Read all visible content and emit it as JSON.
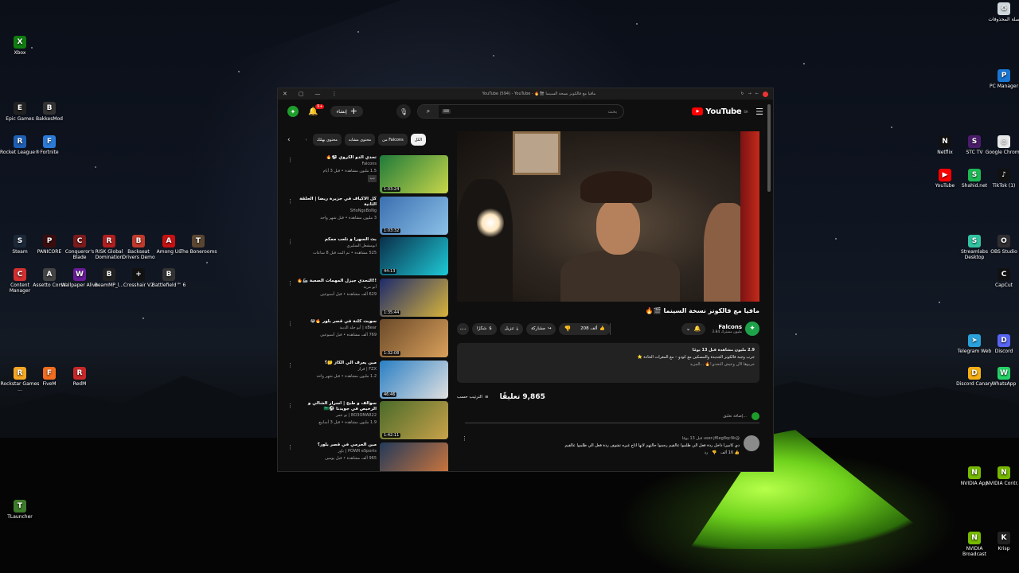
{
  "desktop": {
    "left_icons": [
      {
        "label": "Xbox",
        "icon": "xbox-icon",
        "color": "#107c10",
        "glyph": "X"
      },
      {
        "label": "Epic Games",
        "icon": "epic-games-icon",
        "color": "#222222",
        "glyph": "E"
      },
      {
        "label": "BakkesMod",
        "icon": "bakkesmod-icon",
        "color": "#333333",
        "glyph": "B"
      },
      {
        "label": "Rocket League®",
        "icon": "rocket-league-icon",
        "color": "#1e5fb4",
        "glyph": "R"
      },
      {
        "label": "Fortnite",
        "icon": "fortnite-icon",
        "color": "#2a7bd8",
        "glyph": "F"
      },
      {
        "label": "Steam",
        "icon": "steam-icon",
        "color": "#1b2838",
        "glyph": "S"
      },
      {
        "label": "PANICORE",
        "icon": "panicore-icon",
        "color": "#3a0c0c",
        "glyph": "P"
      },
      {
        "label": "Conqueror's Blade",
        "icon": "conquerors-blade-icon",
        "color": "#7a1a1a",
        "glyph": "C"
      },
      {
        "label": "RISK Global Domination",
        "icon": "risk-icon",
        "color": "#b01e1e",
        "glyph": "R"
      },
      {
        "label": "Backseat Drivers Demo",
        "icon": "backseat-drivers-icon",
        "color": "#c0392b",
        "glyph": "B"
      },
      {
        "label": "Among Us",
        "icon": "among-us-icon",
        "color": "#c51111",
        "glyph": "A"
      },
      {
        "label": "The Bonerooms",
        "icon": "bonerooms-icon",
        "color": "#5a4630",
        "glyph": "T"
      },
      {
        "label": "Content Manager",
        "icon": "content-manager-icon",
        "color": "#d32f2f",
        "glyph": "C"
      },
      {
        "label": "Assetto Corsa",
        "icon": "assetto-corsa-icon",
        "color": "#444444",
        "glyph": "A"
      },
      {
        "label": "Wallpaper Alive",
        "icon": "wallpaper-alive-icon",
        "color": "#6a1b9a",
        "glyph": "W"
      },
      {
        "label": "BeamMP_l...",
        "icon": "beammp-icon",
        "color": "#222222",
        "glyph": "B"
      },
      {
        "label": "Crosshair V2",
        "icon": "crosshair-icon",
        "color": "#111111",
        "glyph": "+"
      },
      {
        "label": "Battlefield™ 6",
        "icon": "battlefield-icon",
        "color": "#333333",
        "glyph": "B"
      },
      {
        "label": "Rockstar Games ...",
        "icon": "rockstar-icon",
        "color": "#f5a623",
        "glyph": "R"
      },
      {
        "label": "FiveM",
        "icon": "fivem-icon",
        "color": "#f06c1e",
        "glyph": "F"
      },
      {
        "label": "RedM",
        "icon": "redm-icon",
        "color": "#c62828",
        "glyph": "R"
      },
      {
        "label": "TLauncher",
        "icon": "tlauncher-icon",
        "color": "#3d7a2a",
        "glyph": "T"
      }
    ],
    "right_icons": [
      {
        "label": "سلة المحذوفات",
        "icon": "recycle-bin-icon",
        "color": "#cfd8dc",
        "glyph": "♻"
      },
      {
        "label": "PC Manager",
        "icon": "pc-manager-icon",
        "color": "#1976d2",
        "glyph": "P"
      },
      {
        "label": "Netflix",
        "icon": "netflix-icon",
        "color": "#111111",
        "glyph": "N"
      },
      {
        "label": "STC TV",
        "icon": "stc-tv-icon",
        "color": "#4b1c6b",
        "glyph": "S"
      },
      {
        "label": "Google Chrome",
        "icon": "chrome-icon",
        "color": "#e8e8e8",
        "glyph": "◎"
      },
      {
        "label": "YouTube",
        "icon": "youtube-icon",
        "color": "#ff0000",
        "glyph": "▶"
      },
      {
        "label": "Shahid.net",
        "icon": "shahid-icon",
        "color": "#1db954",
        "glyph": "S"
      },
      {
        "label": "TikTok (1)",
        "icon": "tiktok-icon",
        "color": "#111111",
        "glyph": "♪"
      },
      {
        "label": "Streamlabs Desktop",
        "icon": "streamlabs-icon",
        "color": "#31c3a2",
        "glyph": "S"
      },
      {
        "label": "OBS Studio",
        "icon": "obs-icon",
        "color": "#302e31",
        "glyph": "O"
      },
      {
        "label": "CapCut",
        "icon": "capcut-icon",
        "color": "#111111",
        "glyph": "C"
      },
      {
        "label": "Telegram Web",
        "icon": "telegram-icon",
        "color": "#2aa1da",
        "glyph": "➤"
      },
      {
        "label": "Discord",
        "icon": "discord-icon",
        "color": "#5865f2",
        "glyph": "D"
      },
      {
        "label": "Discord Canary",
        "icon": "discord-canary-icon",
        "color": "#f5b014",
        "glyph": "D"
      },
      {
        "label": "WhatsApp",
        "icon": "whatsapp-icon",
        "color": "#25d366",
        "glyph": "W"
      },
      {
        "label": "NVIDIA App",
        "icon": "nvidia-app-icon",
        "color": "#76b900",
        "glyph": "N"
      },
      {
        "label": "NVIDIA Contr...",
        "icon": "nvidia-control-icon",
        "color": "#76b900",
        "glyph": "N"
      },
      {
        "label": "NVIDIA Broadcast",
        "icon": "nvidia-broadcast-icon",
        "color": "#76b900",
        "glyph": "N"
      },
      {
        "label": "Krisp",
        "icon": "krisp-icon",
        "color": "#222222",
        "glyph": "K"
      }
    ]
  },
  "window": {
    "title": "مافيا مع فالكونز نسخة السينما 🎬🔥 - YouTube (594) - YouTube"
  },
  "header": {
    "create_label": "إنشاء",
    "notifications": "9+",
    "search_placeholder": "بحث",
    "search_kbd": "⌨",
    "logo_text": "YouTube",
    "logo_region": "SA"
  },
  "video": {
    "title": "مافيا مع فالكونز نسخة السينما 🎬🔥",
    "channel": "Falcons",
    "subscribers": "3.84 مليون مشترك",
    "likes": "208 ألف",
    "share": "مشاركة",
    "download": "تنزيل",
    "thanks": "شكرًا",
    "desc_stats": "2.9 مليون مشاهدة قبل 13 يومًا",
    "desc_line": "جرب وجبة فالكونز الجديدة والمسكين مع كودو – مع المغرات الحادة ⭐",
    "desc_more": "جربوها الآن وعيش التحدي!🔥 ...المزيد"
  },
  "comments": {
    "count": "9,865 تعليقًا",
    "sort_label": "الترتيب حسب",
    "add_placeholder": "إضافة تعليق...",
    "first": {
      "user": "@user-jf6eg8qc9k",
      "time": "قبل 13 يومًا",
      "text": "دي كاميرا داخل ردة فعل الي ظلموا عالقيم رجموا حالتهم لانها اتاح غيره تشوف ردة فعل الي ظلموا عالقيم",
      "likes": "16 ألف",
      "reply": "رد"
    }
  },
  "related": {
    "chips": [
      "الكل",
      "من Falcons",
      "محتوى مشابه",
      "محتوى يهمّك"
    ],
    "items": [
      {
        "title": "تحدي الدو الكروي ⚽🔥",
        "channel": "Falcons",
        "views": "1.5 مليون مشاهدة • قبل 3 أيام",
        "tag": "جديد",
        "duration": "1:03:24",
        "c1": "#1f7a3a",
        "c2": "#c8d64a"
      },
      {
        "title": "كل الأكياف في جزيرة ريضا | الحلقة الثانية",
        "channel": "SHoNgxBoNg",
        "views": "3 مليون مشاهدة • قبل شهر واحد",
        "tag": "",
        "duration": "1:03:32",
        "c1": "#3a6fb0",
        "c2": "#8cc1e8"
      },
      {
        "title": "بث السهرا و نلعب ممكم",
        "channel": "ابومشعل السليري",
        "views": "525 مشاهدة • تم البث قبل 8 ساعات",
        "tag": "",
        "duration": "44:13",
        "c1": "#0a2f4a",
        "c2": "#1ec9d6"
      },
      {
        "title": "!!التحدي جيزل المهمات الصعبة 🦾🔥",
        "channel": "أبو مرية",
        "views": "629 ألف مشاهدة • قبل أسبوعين",
        "tag": "",
        "duration": "1:35:44",
        "c1": "#1d2b6b",
        "c2": "#d8b33c"
      },
      {
        "title": "سويت كلنة في قصر بلور 🔥😂",
        "channel": "xBear | أبو جلد الدببة",
        "views": "769 ألف مشاهدة • قبل أسبوعين",
        "tag": "",
        "duration": "1:32:08",
        "c1": "#6b4a2a",
        "c2": "#d9a05b"
      },
      {
        "title": "مين يعرف الي الكاز 🤔؟",
        "channel": "FZX | فراز",
        "views": "1.2 مليون مشاهدة • قبل شهر واحد",
        "tag": "",
        "duration": "46:46",
        "c1": "#2a7fc4",
        "c2": "#e0e0e0"
      },
      {
        "title": "سوالف و طبخ | اسرار الشالي و الرخيص في جويدنا ⚽🇸🇦",
        "channel": "BO3OMAR22 | بو عمر",
        "views": "1.9 مليون مشاهدة • قبل 3 أسابيع",
        "tag": "",
        "duration": "1:42:11",
        "c1": "#4a6b2a",
        "c2": "#c9a24a"
      },
      {
        "title": "مين الحرمي في قصر بلور؟",
        "channel": "POWR eSports | باور",
        "views": "965 ألف مشاهدة • قبل يومين",
        "tag": "",
        "duration": "53:26",
        "c1": "#233a5a",
        "c2": "#d87a3a"
      }
    ]
  }
}
